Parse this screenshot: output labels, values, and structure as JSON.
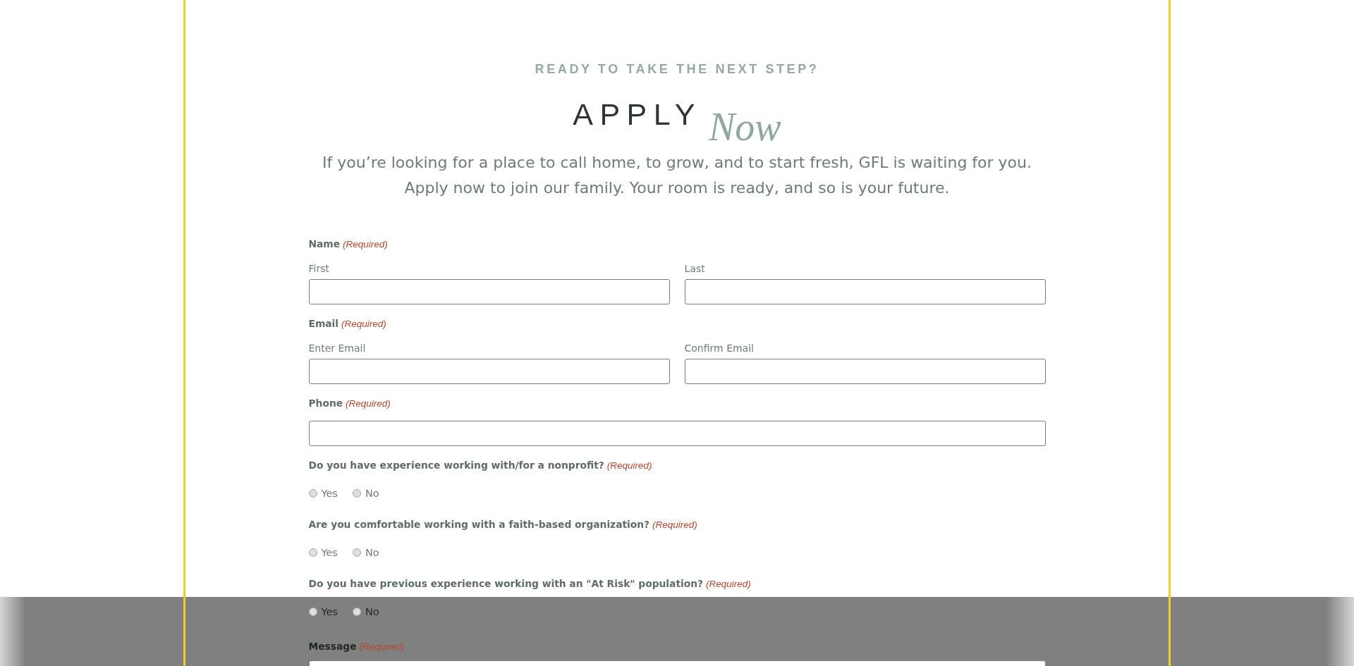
{
  "header": {
    "eyebrow": "READY TO TAKE THE NEXT STEP?",
    "title": "APPLY",
    "accent": "Now",
    "intro": [
      "If you’re looking for a place to call home, to grow, and to start fresh, GFL is waiting for you.",
      "Apply now to join our family. Your room is ready, and so is your future."
    ]
  },
  "form": {
    "fields": [
      {
        "kind": "split",
        "label": "Name",
        "note": "(Required)",
        "inputs": [
          {
            "label": "First"
          },
          {
            "label": "Last"
          }
        ]
      },
      {
        "kind": "split",
        "label": "Email",
        "note": "(Required)",
        "inputs": [
          {
            "label": "Enter Email"
          },
          {
            "label": "Confirm Email"
          }
        ]
      },
      {
        "kind": "text",
        "label": "Phone",
        "note": "(Required)"
      },
      {
        "kind": "radio",
        "label": "Do you have experience working with/for a nonprofit?",
        "note": "(Required)",
        "options": [
          {
            "label": "Yes",
            "selected": false
          },
          {
            "label": "No",
            "selected": false
          }
        ]
      },
      {
        "kind": "radio",
        "label": "Are you comfortable working with a faith-based organization?",
        "note": "(Required)",
        "options": [
          {
            "label": "Yes",
            "selected": false
          },
          {
            "label": "No",
            "selected": false
          }
        ]
      },
      {
        "kind": "radio",
        "label": "Do you have previous experience working with an \"At Risk\" population?",
        "note": "(Required)",
        "options": [
          {
            "label": "Yes",
            "selected": false
          },
          {
            "label": "No",
            "selected": false
          }
        ]
      },
      {
        "kind": "textarea",
        "label": "Message",
        "note": "(Required)"
      }
    ]
  }
}
